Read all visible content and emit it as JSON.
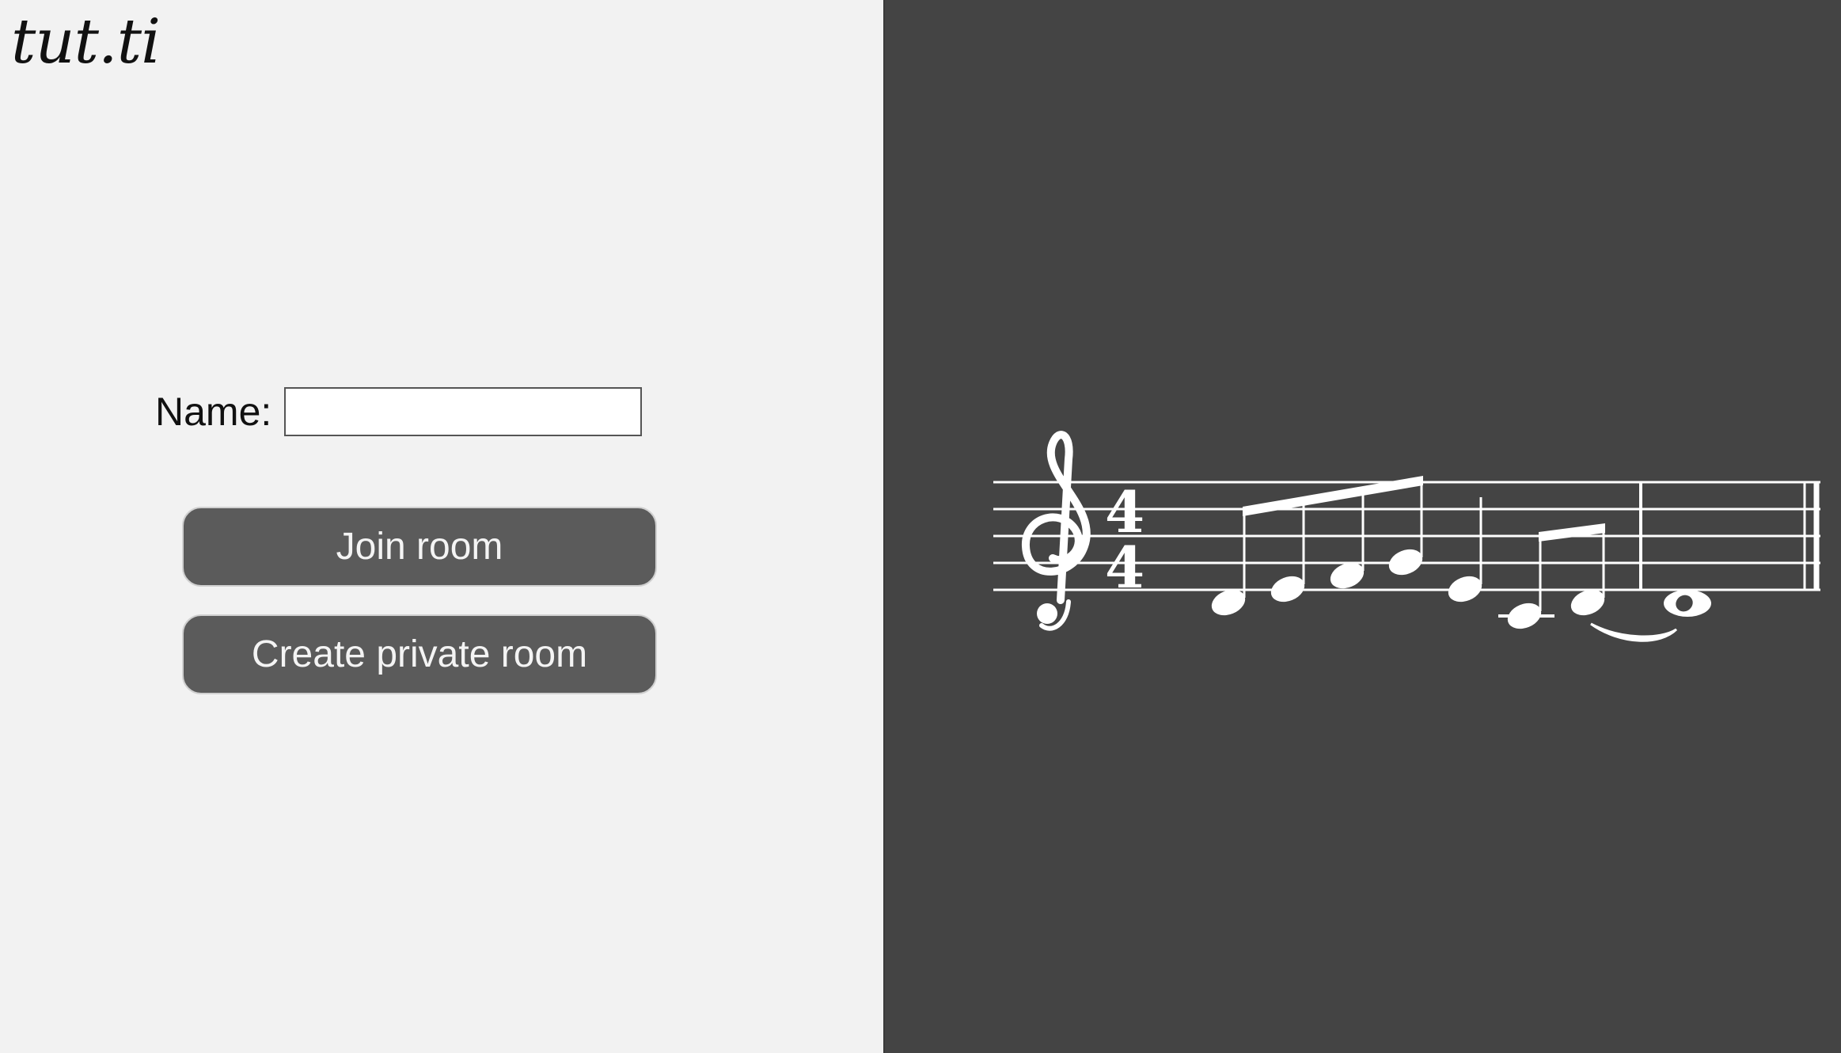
{
  "app": {
    "logo_text": "tut.ti"
  },
  "form": {
    "name_label": "Name:",
    "name_value": "",
    "name_placeholder": "",
    "join_button_label": "Join room",
    "create_button_label": "Create private room"
  },
  "colors": {
    "left_background": "#f2f2f2",
    "right_background": "#444444",
    "button_background": "#5b5b5b",
    "button_text": "#f4f4f4",
    "notation": "#ffffff"
  },
  "score": {
    "clef": "treble",
    "time_signature": "4/4",
    "notes": [
      "D4 eighth",
      "E4 eighth",
      "F4 eighth",
      "G4 eighth",
      "E4 quarter",
      "C4 eighth",
      "D4 eighth tied",
      "D4 whole"
    ]
  }
}
